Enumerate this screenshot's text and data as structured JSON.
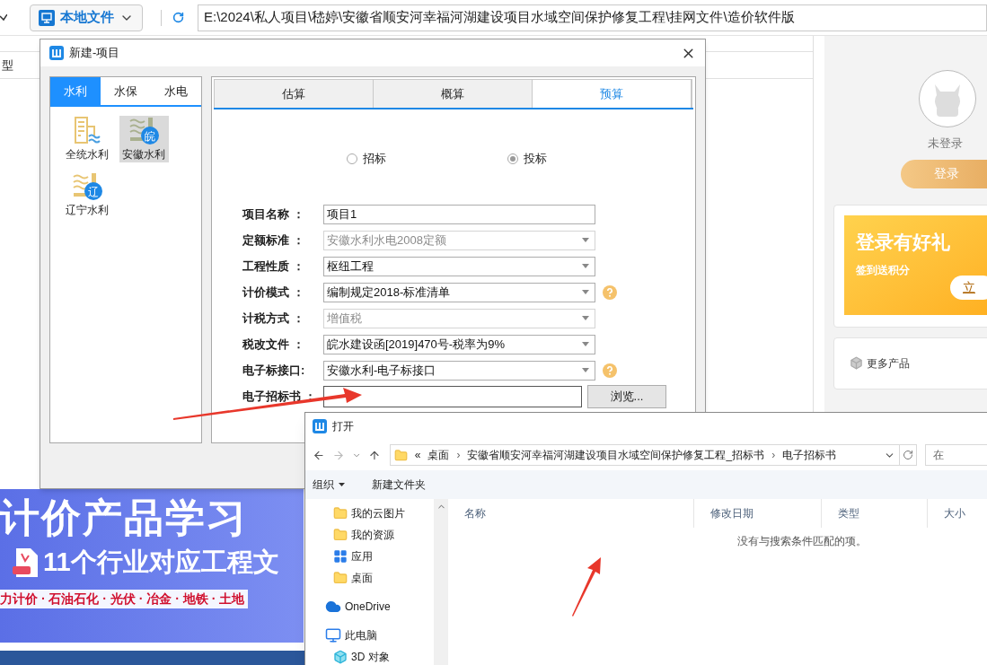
{
  "toolbar": {
    "source_button": "本地文件",
    "path": "E:\\2024\\私人项目\\嵇婷\\安徽省顺安河幸福河湖建设项目水域空间保护修复工程\\挂网文件\\造价软件版"
  },
  "table": {
    "columns": [
      "型"
    ]
  },
  "account": {
    "status": "未登录",
    "login_button": "登录",
    "promo": {
      "title": "登录有好礼",
      "subtitle": "签到送积分",
      "button": "立"
    },
    "more_products": "更多产品"
  },
  "banner": {
    "headline": "计价产品学习",
    "subline": "11个行业对应工程文",
    "tags": "力计价 · 石油石化 · 光伏 · 冶金 · 地铁 · 土地"
  },
  "new_project_dialog": {
    "title": "新建-项目",
    "categories": [
      {
        "label": "水利",
        "selected": true
      },
      {
        "label": "水保",
        "selected": false
      },
      {
        "label": "水电",
        "selected": false
      }
    ],
    "templates": [
      {
        "label": "全统水利",
        "kind": "building",
        "selected": false
      },
      {
        "label": "安徽水利",
        "kind": "regional",
        "badge": "皖",
        "selected": true
      },
      {
        "label": "辽宁水利",
        "kind": "regional",
        "badge": "辽",
        "selected": false
      }
    ],
    "stages": [
      {
        "label": "估算",
        "selected": false
      },
      {
        "label": "概算",
        "selected": false
      },
      {
        "label": "预算",
        "selected": true
      }
    ],
    "bid_types": [
      {
        "label": "招标",
        "selected": false
      },
      {
        "label": "投标",
        "selected": true
      }
    ],
    "fields": [
      {
        "label": "项目名称 ：",
        "kind": "text",
        "value": "项目1",
        "disabled": false,
        "help": false
      },
      {
        "label": "定额标准 ：",
        "kind": "select",
        "value": "安徽水利水电2008定额",
        "disabled": true,
        "help": false
      },
      {
        "label": "工程性质 ：",
        "kind": "select",
        "value": "枢纽工程",
        "disabled": false,
        "help": false
      },
      {
        "label": "计价模式 ：",
        "kind": "select",
        "value": "编制规定2018-标准清单",
        "disabled": false,
        "help": true
      },
      {
        "label": "计税方式 ：",
        "kind": "select",
        "value": "增值税",
        "disabled": true,
        "help": false
      },
      {
        "label": "税改文件 ：",
        "kind": "select",
        "value": "皖水建设函[2019]470号-税率为9%",
        "disabled": false,
        "help": false
      },
      {
        "label": "电子标接口:",
        "kind": "select",
        "value": "安徽水利-电子标接口",
        "disabled": false,
        "help": true
      },
      {
        "label": "电子招标书 ：",
        "kind": "file",
        "button": "浏览...",
        "disabled": false,
        "help": false
      }
    ]
  },
  "open_dialog": {
    "title": "打开",
    "breadcrumb": {
      "overflow": "«",
      "items": [
        {
          "label": "桌面"
        },
        {
          "separator": "›",
          "label": "安徽省顺安河幸福河湖建设项目水域空间保护修复工程_招标书"
        },
        {
          "separator": "›",
          "label": "电子招标书"
        }
      ]
    },
    "search": {
      "placeholder": "在"
    },
    "commands": {
      "organize": "组织",
      "new_folder": "新建文件夹"
    },
    "nav": [
      {
        "label": "我的云图片",
        "kind": "folder"
      },
      {
        "label": "我的资源",
        "kind": "folder"
      },
      {
        "label": "应用",
        "kind": "apps"
      },
      {
        "label": "桌面",
        "kind": "folder"
      },
      {
        "label": "OneDrive",
        "kind": "cloud"
      },
      {
        "label": "此电脑",
        "kind": "pc"
      },
      {
        "label": "3D 对象",
        "kind": "cube"
      }
    ],
    "columns": [
      "名称",
      "修改日期",
      "类型",
      "大小"
    ],
    "empty_message": "没有与搜索条件匹配的项。"
  }
}
